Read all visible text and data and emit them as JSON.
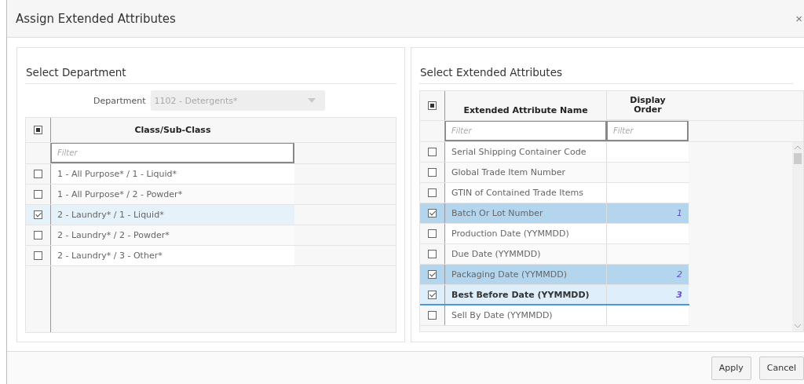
{
  "window": {
    "title": "Assign Extended Attributes",
    "close": "×"
  },
  "department_panel": {
    "title": "Select Department",
    "department_label": "Department",
    "department_value": "1102 - Detergents*",
    "department_disabled": true,
    "header_checkbox_partial": true,
    "column": "Class/Sub-Class",
    "filter_placeholder": "Filter",
    "rows": [
      {
        "name": "1 - All Purpose* / 1 - Liquid*",
        "checked": false,
        "selected": false
      },
      {
        "name": "1 - All Purpose* / 2 - Powder*",
        "checked": false,
        "selected": false
      },
      {
        "name": "2 - Laundry* / 1 - Liquid*",
        "checked": true,
        "selected": true
      },
      {
        "name": "2 - Laundry* / 2 - Powder*",
        "checked": false,
        "selected": false
      },
      {
        "name": "2 - Laundry* / 3 - Other*",
        "checked": false,
        "selected": false
      }
    ]
  },
  "attributes_panel": {
    "title": "Select Extended Attributes",
    "header_checkbox_partial": true,
    "columns": [
      "Extended Attribute Name",
      "Display Order"
    ],
    "filter_placeholders": [
      "Filter",
      "Filter"
    ],
    "rows": [
      {
        "name": "Serial Shipping Container Code",
        "checked": false,
        "selected": false,
        "current": false
      },
      {
        "name": "Global Trade Item Number",
        "checked": false,
        "selected": false,
        "current": false
      },
      {
        "name": "GTIN of Contained Trade Items",
        "checked": false,
        "selected": false,
        "current": false
      },
      {
        "name": "Batch Or Lot Number",
        "order": "1",
        "checked": true,
        "selected": true,
        "current": false
      },
      {
        "name": "Production Date (YYMMDD)",
        "checked": false,
        "selected": false,
        "current": false
      },
      {
        "name": "Due Date (YYMMDD)",
        "checked": false,
        "selected": false,
        "current": false
      },
      {
        "name": "Packaging Date (YYMMDD)",
        "order": "2",
        "checked": true,
        "selected": true,
        "current": false
      },
      {
        "name": "Best Before Date (YYMMDD)",
        "order": "3",
        "checked": true,
        "selected": false,
        "current": true
      },
      {
        "name": "Sell By Date (YYMMDD)",
        "checked": false,
        "selected": false,
        "current": false
      }
    ]
  },
  "buttons": [
    "Apply",
    "Cancel"
  ]
}
